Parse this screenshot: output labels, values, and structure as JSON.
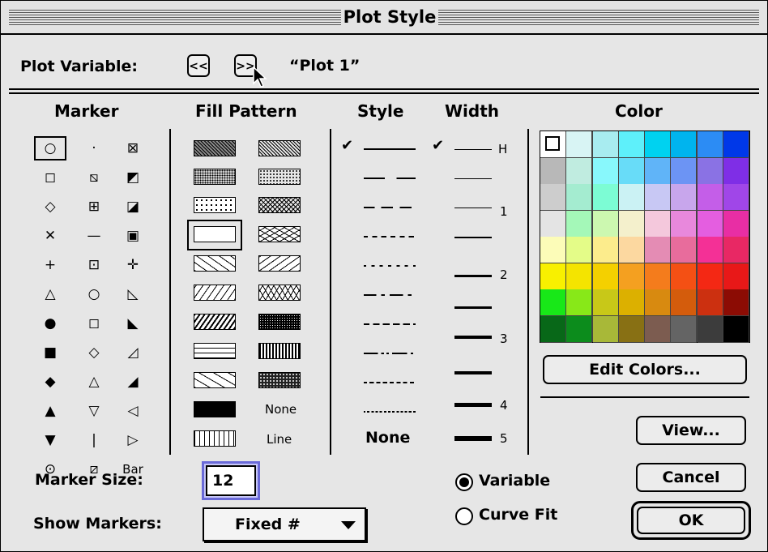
{
  "window": {
    "title": "Plot Style"
  },
  "plot_variable": {
    "label": "Plot Variable:",
    "prev_label": "<<",
    "next_label": ">>",
    "value": "“Plot 1”"
  },
  "headers": {
    "marker": "Marker",
    "fill": "Fill Pattern",
    "style": "Style",
    "width": "Width",
    "color": "Color"
  },
  "marker_rows": [
    [
      "○",
      "·",
      "⊠"
    ],
    [
      "◻",
      "⧅",
      "◩"
    ],
    [
      "◇",
      "⊞",
      "◪"
    ],
    [
      "✕",
      "—",
      "▣"
    ],
    [
      "+",
      "⊡",
      "✛"
    ],
    [
      "△",
      "○",
      "◺"
    ],
    [
      "●",
      "◻",
      "◣"
    ],
    [
      "■",
      "◇",
      "◿"
    ],
    [
      "◆",
      "△",
      "◢"
    ],
    [
      "▲",
      "▽",
      "◁"
    ],
    [
      "▼",
      "|",
      "▷"
    ],
    [
      "⊙",
      "⧄",
      "Bar"
    ]
  ],
  "fill": {
    "none_label": "None",
    "line_label": "Line"
  },
  "style": {
    "none_label": "None",
    "check": "✔"
  },
  "width": {
    "labels": [
      "H",
      "1",
      "2",
      "3",
      "4",
      "5"
    ],
    "check": "✔"
  },
  "colors": [
    "#ffffff",
    "#d8f4f4",
    "#a8ecf0",
    "#5ef0fa",
    "#00d2f0",
    "#00b4ee",
    "#2c8cf4",
    "#0038e8",
    "#b8b8b8",
    "#c0ece0",
    "#88f8fc",
    "#68dcf8",
    "#60b4f8",
    "#6c94f4",
    "#8a72e4",
    "#7f2ee6",
    "#cdcdcd",
    "#a4ecd0",
    "#7cfcd4",
    "#cbf2f4",
    "#c8c8f4",
    "#c8a6ec",
    "#c45ee8",
    "#a046e8",
    "#e4e4e4",
    "#a4f8b8",
    "#ccf8b0",
    "#f4f0cc",
    "#f4c8dc",
    "#e888dc",
    "#e45ee0",
    "#e82ea4",
    "#fcfcb8",
    "#e4fc88",
    "#fcec8c",
    "#fcd8a0",
    "#e48cb4",
    "#e86c9c",
    "#f43096",
    "#e82864",
    "#f8f000",
    "#f4e400",
    "#f4d000",
    "#f4a020",
    "#f47c1c",
    "#f45014",
    "#f42814",
    "#e81818",
    "#18e818",
    "#88e818",
    "#c8c818",
    "#dcb000",
    "#d88a10",
    "#d45c0c",
    "#cc3010",
    "#8c0c04",
    "#086818",
    "#0c8c1c",
    "#a8b838",
    "#887014",
    "#7c5c50",
    "#646464",
    "#3c3c3c",
    "#000000"
  ],
  "buttons": {
    "edit_colors": "Edit Colors...",
    "view": "View...",
    "cancel": "Cancel",
    "ok": "OK"
  },
  "marker_size": {
    "label": "Marker Size:",
    "value": "12"
  },
  "show_markers": {
    "label": "Show Markers:",
    "value": "Fixed #"
  },
  "mode": {
    "variable": "Variable",
    "curve_fit": "Curve Fit",
    "selected": "Variable"
  }
}
